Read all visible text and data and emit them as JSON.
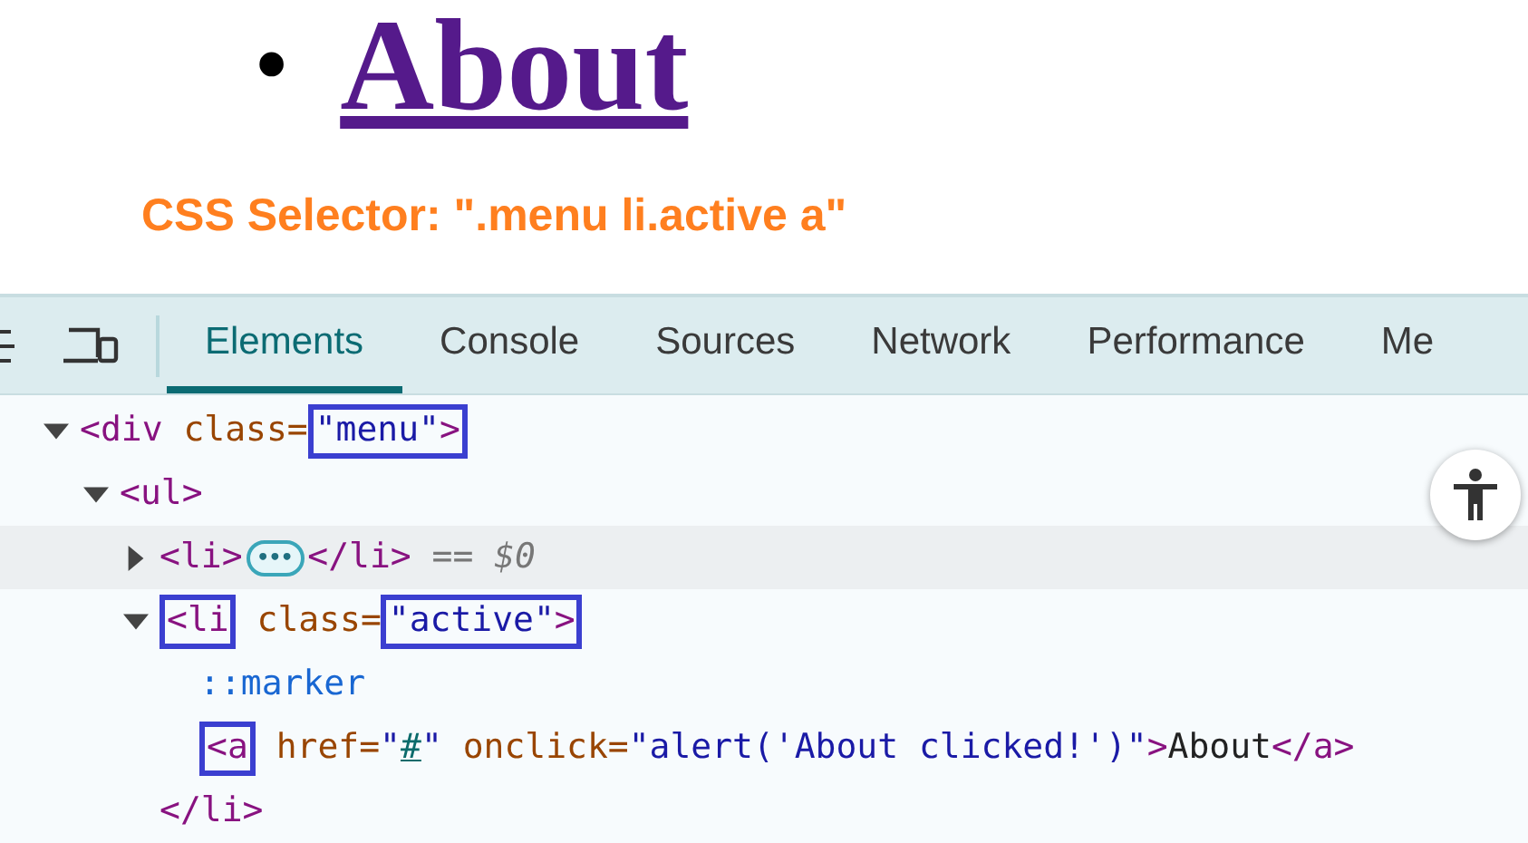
{
  "page": {
    "bullet": "•",
    "link": "About",
    "heading": "CSS Selector: \".menu li.active a\""
  },
  "devtools": {
    "tabs": [
      {
        "label": "Elements",
        "selected": true
      },
      {
        "label": "Console",
        "selected": false
      },
      {
        "label": "Sources",
        "selected": false
      },
      {
        "label": "Network",
        "selected": false
      },
      {
        "label": "Performance",
        "selected": false
      },
      {
        "label": "Me",
        "selected": false
      }
    ],
    "tree": [
      {
        "expanded": true,
        "selected": false,
        "tokens": [
          {
            "kind": "tag",
            "text": "<div"
          },
          {
            "kind": "attr",
            "text": " class="
          },
          {
            "kind": "box",
            "tokens": [
              {
                "kind": "value",
                "text": "\"menu\""
              },
              {
                "kind": "tag",
                "text": ">"
              }
            ]
          }
        ],
        "children": [
          {
            "expanded": true,
            "selected": false,
            "tokens": [
              {
                "kind": "tag",
                "text": "<ul>"
              }
            ],
            "children": [
              {
                "expanded": false,
                "selected": true,
                "tokens": [
                  {
                    "kind": "tag",
                    "text": "<li>"
                  },
                  {
                    "kind": "ellipsis",
                    "text": "•••"
                  },
                  {
                    "kind": "tag",
                    "text": "</li>"
                  },
                  {
                    "kind": "ref",
                    "text": " == $0"
                  }
                ]
              },
              {
                "expanded": true,
                "selected": false,
                "tokens": [
                  {
                    "kind": "box",
                    "tokens": [
                      {
                        "kind": "tag",
                        "text": "<li"
                      }
                    ]
                  },
                  {
                    "kind": "attr",
                    "text": " class="
                  },
                  {
                    "kind": "box",
                    "tokens": [
                      {
                        "kind": "value",
                        "text": "\"active\""
                      },
                      {
                        "kind": "tag",
                        "text": ">"
                      }
                    ]
                  }
                ],
                "children": [
                  {
                    "selected": false,
                    "tokens": [
                      {
                        "kind": "pseudo",
                        "text": "::marker"
                      }
                    ]
                  },
                  {
                    "selected": false,
                    "tokens": [
                      {
                        "kind": "box",
                        "tokens": [
                          {
                            "kind": "tag",
                            "text": "<a"
                          }
                        ]
                      },
                      {
                        "kind": "attr",
                        "text": " href="
                      },
                      {
                        "kind": "value",
                        "text": "\""
                      },
                      {
                        "kind": "link",
                        "text": "#"
                      },
                      {
                        "kind": "value",
                        "text": "\""
                      },
                      {
                        "kind": "attr",
                        "text": " onclick="
                      },
                      {
                        "kind": "value",
                        "text": "\"alert('About clicked!')\""
                      },
                      {
                        "kind": "tag",
                        "text": ">"
                      },
                      {
                        "kind": "text",
                        "text": "About"
                      },
                      {
                        "kind": "tag",
                        "text": "</a>"
                      }
                    ]
                  }
                ]
              },
              {
                "selected": false,
                "tokens": [
                  {
                    "kind": "tag",
                    "text": "</li>"
                  }
                ]
              }
            ]
          }
        ]
      }
    ]
  }
}
